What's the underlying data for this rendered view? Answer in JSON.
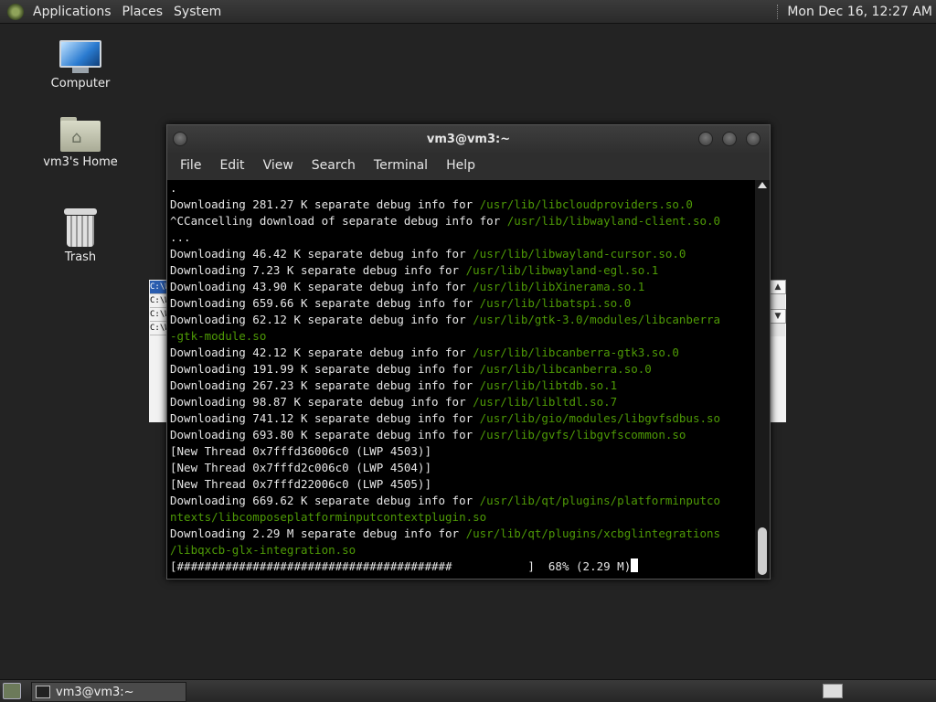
{
  "top_panel": {
    "menus": [
      "Applications",
      "Places",
      "System"
    ],
    "clock": "Mon Dec 16, 12:27 AM"
  },
  "desktop_icons": {
    "computer": "Computer",
    "home": "vm3's Home",
    "trash": "Trash"
  },
  "background_window": {
    "rows": [
      "C:\\W",
      "C:\\W",
      "C:\\W",
      "C:\\W"
    ]
  },
  "terminal": {
    "title": "vm3@vm3:~",
    "menu": [
      "File",
      "Edit",
      "View",
      "Search",
      "Terminal",
      "Help"
    ],
    "lines": [
      {
        "text": "."
      },
      {
        "text": "Downloading 281.27 K separate debug info for ",
        "path": "/usr/lib/libcloudproviders.so.0"
      },
      {
        "text": "^CCancelling download of separate debug info for ",
        "path": "/usr/lib/libwayland-client.so.0"
      },
      {
        "text": "..."
      },
      {
        "text": "Downloading 46.42 K separate debug info for ",
        "path": "/usr/lib/libwayland-cursor.so.0"
      },
      {
        "text": "Downloading 7.23 K separate debug info for ",
        "path": "/usr/lib/libwayland-egl.so.1"
      },
      {
        "text": "Downloading 43.90 K separate debug info for ",
        "path": "/usr/lib/libXinerama.so.1"
      },
      {
        "text": "Downloading 659.66 K separate debug info for ",
        "path": "/usr/lib/libatspi.so.0"
      },
      {
        "text": "Downloading 62.12 K separate debug info for ",
        "path": "/usr/lib/gtk-3.0/modules/libcanberra"
      },
      {
        "text": "",
        "path": "-gtk-module.so"
      },
      {
        "text": "Downloading 42.12 K separate debug info for ",
        "path": "/usr/lib/libcanberra-gtk3.so.0"
      },
      {
        "text": "Downloading 191.99 K separate debug info for ",
        "path": "/usr/lib/libcanberra.so.0"
      },
      {
        "text": "Downloading 267.23 K separate debug info for ",
        "path": "/usr/lib/libtdb.so.1"
      },
      {
        "text": "Downloading 98.87 K separate debug info for ",
        "path": "/usr/lib/libltdl.so.7"
      },
      {
        "text": "Downloading 741.12 K separate debug info for ",
        "path": "/usr/lib/gio/modules/libgvfsdbus.so"
      },
      {
        "text": "Downloading 693.80 K separate debug info for ",
        "path": "/usr/lib/gvfs/libgvfscommon.so"
      },
      {
        "text": "[New Thread 0x7fffd36006c0 (LWP 4503)]"
      },
      {
        "text": "[New Thread 0x7fffd2c006c0 (LWP 4504)]"
      },
      {
        "text": "[New Thread 0x7fffd22006c0 (LWP 4505)]"
      },
      {
        "text": "Downloading 669.62 K separate debug info for ",
        "path": "/usr/lib/qt/plugins/platforminputco"
      },
      {
        "text": "",
        "path": "ntexts/libcomposeplatforminputcontextplugin.so"
      },
      {
        "text": "Downloading 2.29 M separate debug info for ",
        "path": "/usr/lib/qt/plugins/xcbglintegrations"
      },
      {
        "text": "",
        "path": "/libqxcb-glx-integration.so"
      }
    ],
    "progress_line": "[########################################           ]  68% (2.29 M)"
  },
  "bottom_panel": {
    "task_label": "vm3@vm3:~"
  }
}
